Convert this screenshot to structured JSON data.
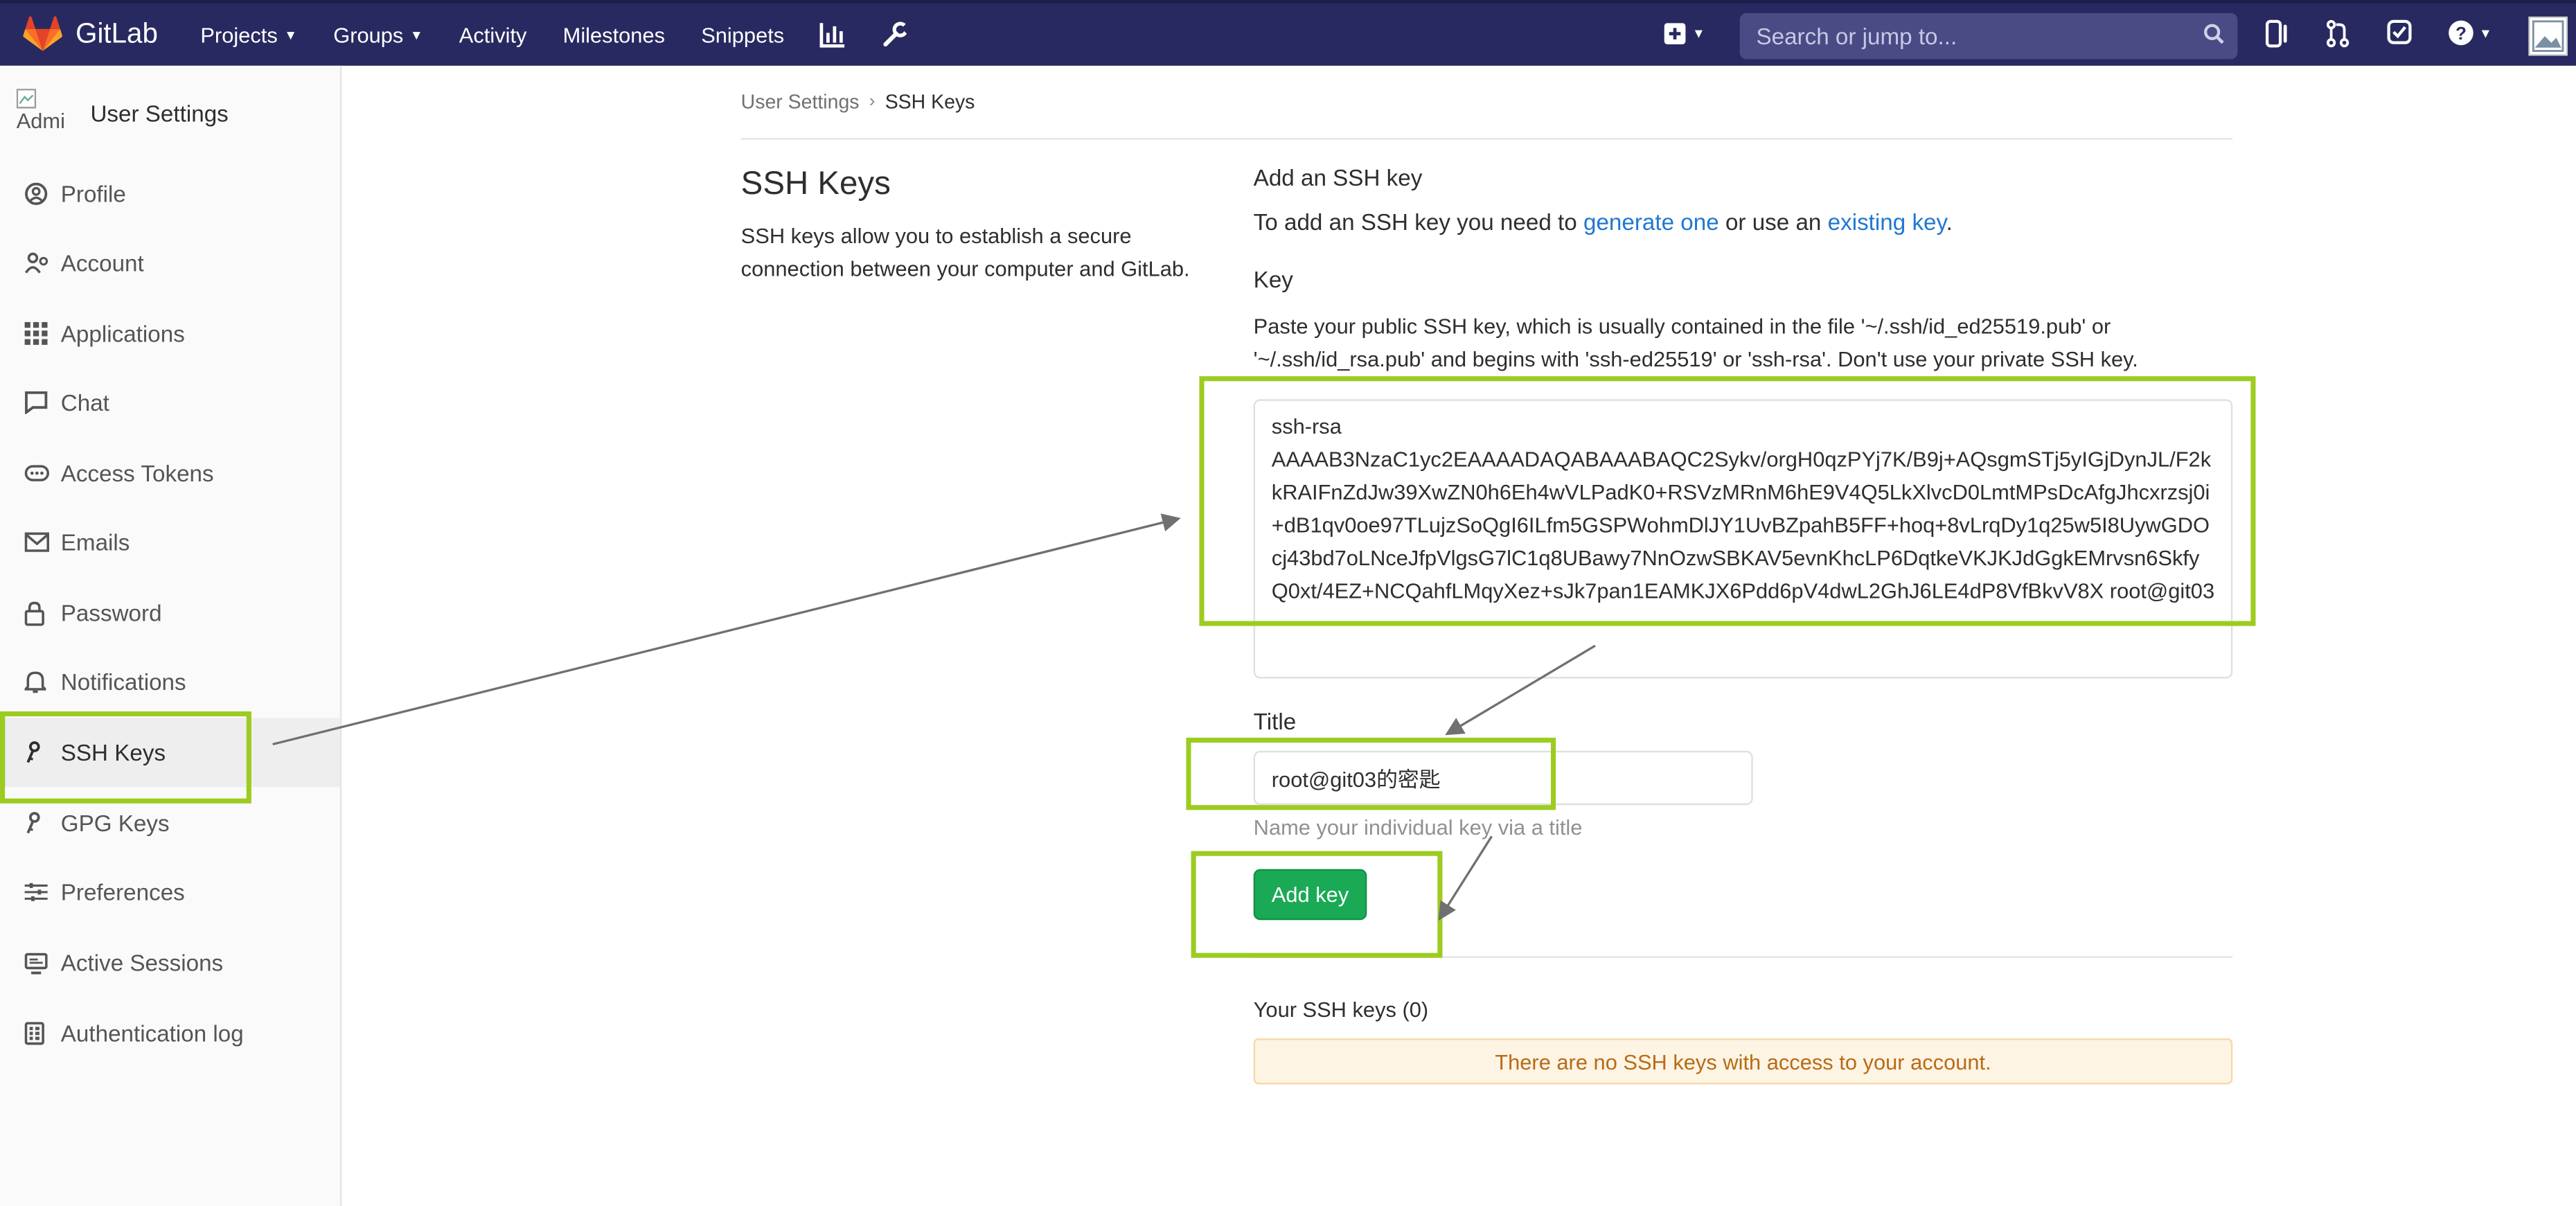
{
  "header": {
    "app_name": "GitLab",
    "nav": [
      {
        "label": "Projects",
        "has_caret": true
      },
      {
        "label": "Groups",
        "has_caret": true
      },
      {
        "label": "Activity",
        "has_caret": false
      },
      {
        "label": "Milestones",
        "has_caret": false
      },
      {
        "label": "Snippets",
        "has_caret": false
      }
    ],
    "search_placeholder": "Search or jump to...",
    "colors": {
      "bar": "#292961",
      "search_bg": "#4a4a85",
      "logo": "#e2432a"
    }
  },
  "sidebar": {
    "avatar_alt": "Admi",
    "title": "User Settings",
    "items": [
      {
        "label": "Profile",
        "icon": "profile-icon"
      },
      {
        "label": "Account",
        "icon": "account-icon"
      },
      {
        "label": "Applications",
        "icon": "applications-icon"
      },
      {
        "label": "Chat",
        "icon": "chat-icon"
      },
      {
        "label": "Access Tokens",
        "icon": "token-icon"
      },
      {
        "label": "Emails",
        "icon": "mail-icon"
      },
      {
        "label": "Password",
        "icon": "lock-icon"
      },
      {
        "label": "Notifications",
        "icon": "bell-icon"
      },
      {
        "label": "SSH Keys",
        "icon": "key-icon",
        "active": true
      },
      {
        "label": "GPG Keys",
        "icon": "key-icon"
      },
      {
        "label": "Preferences",
        "icon": "sliders-icon"
      },
      {
        "label": "Active Sessions",
        "icon": "monitor-icon"
      },
      {
        "label": "Authentication log",
        "icon": "log-icon"
      }
    ]
  },
  "breadcrumb": {
    "parent": "User Settings",
    "current": "SSH Keys"
  },
  "page": {
    "heading": "SSH Keys",
    "description": "SSH keys allow you to establish a secure connection between your computer and GitLab.",
    "add_heading": "Add an SSH key",
    "add_text_before": "To add an SSH key you need to ",
    "add_link1": "generate one",
    "add_text_middle": " or use an ",
    "add_link2": "existing key",
    "add_text_after": ".",
    "key_label": "Key",
    "key_help": "Paste your public SSH key, which is usually contained in the file '~/.ssh/id_ed25519.pub' or '~/.ssh/id_rsa.pub' and begins with 'ssh-ed25519' or 'ssh-rsa'. Don't use your private SSH key.",
    "key_value_line1": "ssh-rsa",
    "key_value_rest": "AAAAB3NzaC1yc2EAAAADAQABAAABAQC2Sykv/orgH0qzPYj7K/B9j+AQsgmSTj5yIGjDynJL/F2kkRAIFnZdJw39XwZN0h6Eh4wVLPadK0+RSVzMRnM6hE9V4Q5LkXlvcD0LmtMPsDcAfgJhcxrzsj0i+dB1qv0oe97TLujzSoQgI6ILfm5GSPWohmDlJY1UvBZpahB5FF+hoq+8vLrqDy1q25w5I8UywGDOcj43bd7oLNceJfpVlgsG7lC1q8UBawy7NnOzwSBKAV5evnKhcLP6DqtkeVKJKJdGgkEMrvsn6SkfyQ0xt/4EZ+NCQahfLMqyXez+sJk7pan1EAMKJX6Pdd6pV4dwL2GhJ6LE4dP8VfBkvV8X root@git03",
    "title_label": "Title",
    "title_value": "root@git03的密匙",
    "title_hint": "Name your individual key via a title",
    "add_button": "Add key",
    "your_keys_heading": "Your SSH keys (0)",
    "empty_message": "There are no SSH keys with access to your account."
  },
  "colors": {
    "accent_green": "#1aaa55",
    "highlight": "#9ccc20",
    "link": "#1f78d1",
    "alert_bg": "#fdf4e4",
    "alert_text": "#b86b16"
  }
}
